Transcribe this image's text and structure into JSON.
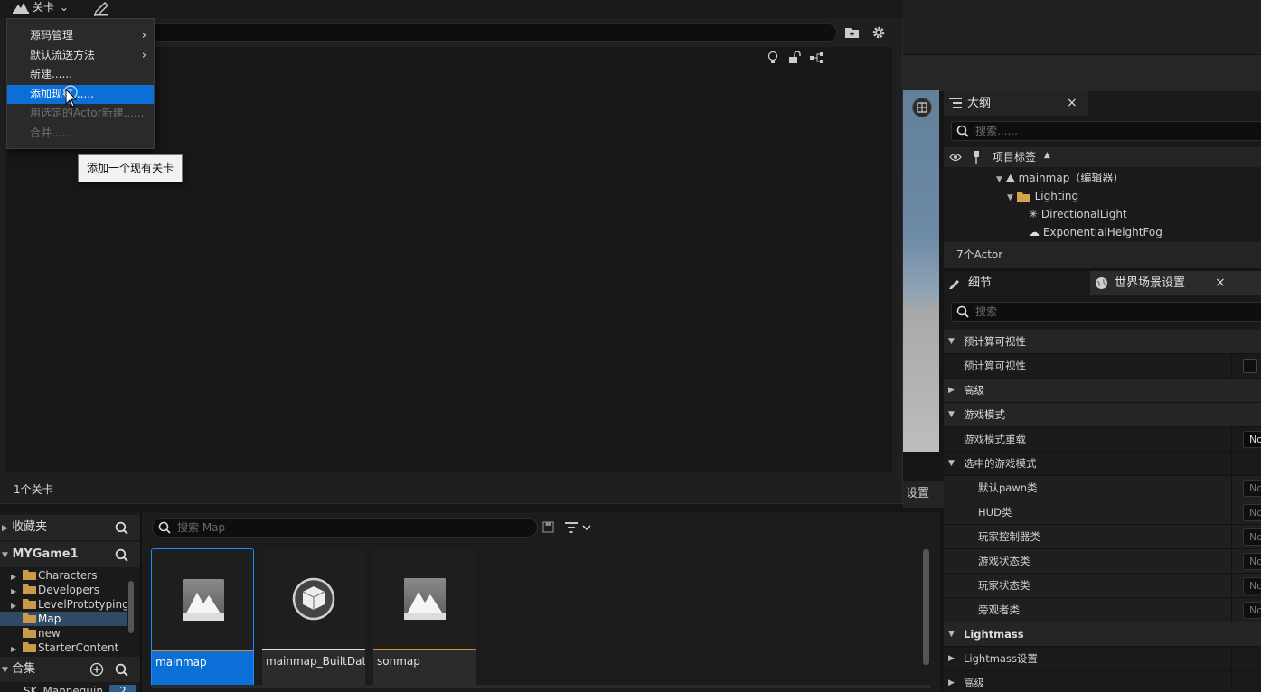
{
  "levels_window": {
    "menu_button": "关卡",
    "status": "1个关卡",
    "menu": {
      "items": [
        {
          "label": "源码管理",
          "submenu": true
        },
        {
          "label": "默认流送方法",
          "submenu": true
        },
        {
          "label": "新建......"
        },
        {
          "label": "添加现有......",
          "active": true
        },
        {
          "label": "用选定的Actor新建......",
          "disabled": true
        },
        {
          "label": "合并......",
          "disabled": true
        }
      ],
      "tooltip": "添加一个现有关卡"
    }
  },
  "viewport": {
    "settings_tab": "设置"
  },
  "outliner": {
    "tab": "大纲",
    "search_placeholder": "搜索......",
    "column_header": "项目标签",
    "tree": [
      "mainmap（编辑器）",
      "Lighting",
      "DirectionalLight",
      "ExponentialHeightFog"
    ],
    "actor_count": "7个Actor"
  },
  "details": {
    "tab_details": "细节",
    "tab_world": "世界场景设置",
    "search_placeholder": "搜索",
    "rows": [
      {
        "label": "预计算可视性",
        "kind": "cat",
        "open": true
      },
      {
        "label": "预计算可视性",
        "kind": "prop",
        "value": "checkbox"
      },
      {
        "label": "高级",
        "kind": "cat",
        "open": false
      },
      {
        "label": "游戏模式",
        "kind": "cat",
        "open": true
      },
      {
        "label": "游戏模式重载",
        "kind": "prop",
        "value": "No"
      },
      {
        "label": "选中的游戏模式",
        "kind": "cat-sub",
        "open": true
      },
      {
        "label": "默认pawn类",
        "kind": "sub",
        "value": "No"
      },
      {
        "label": "HUD类",
        "kind": "sub",
        "value": "No"
      },
      {
        "label": "玩家控制器类",
        "kind": "sub",
        "value": "No"
      },
      {
        "label": "游戏状态类",
        "kind": "sub",
        "value": "No"
      },
      {
        "label": "玩家状态类",
        "kind": "sub",
        "value": "No"
      },
      {
        "label": "旁观者类",
        "kind": "sub",
        "value": "No"
      },
      {
        "label": "Lightmass",
        "kind": "cat",
        "open": true
      },
      {
        "label": "Lightmass设置",
        "kind": "cat-sub",
        "open": false
      },
      {
        "label": "高级",
        "kind": "cat-sub",
        "open": false
      }
    ]
  },
  "content_browser": {
    "favorites": "收藏夹",
    "project": "MYGame1",
    "folders": [
      "Characters",
      "Developers",
      "LevelPrototyping",
      "Map",
      "new",
      "StarterContent"
    ],
    "selected_folder": "Map",
    "collections": "合集",
    "collection_item": "SK_Mannequin",
    "collection_count": "2",
    "search_placeholder": "搜索 Map",
    "assets": [
      {
        "name": "mainmap",
        "type": "level",
        "color": "#e58a2c"
      },
      {
        "name": "mainmap_BuiltData",
        "type": "data",
        "color": "#e0e0e0"
      },
      {
        "name": "sonmap",
        "type": "level",
        "color": "#e58a2c"
      }
    ]
  }
}
